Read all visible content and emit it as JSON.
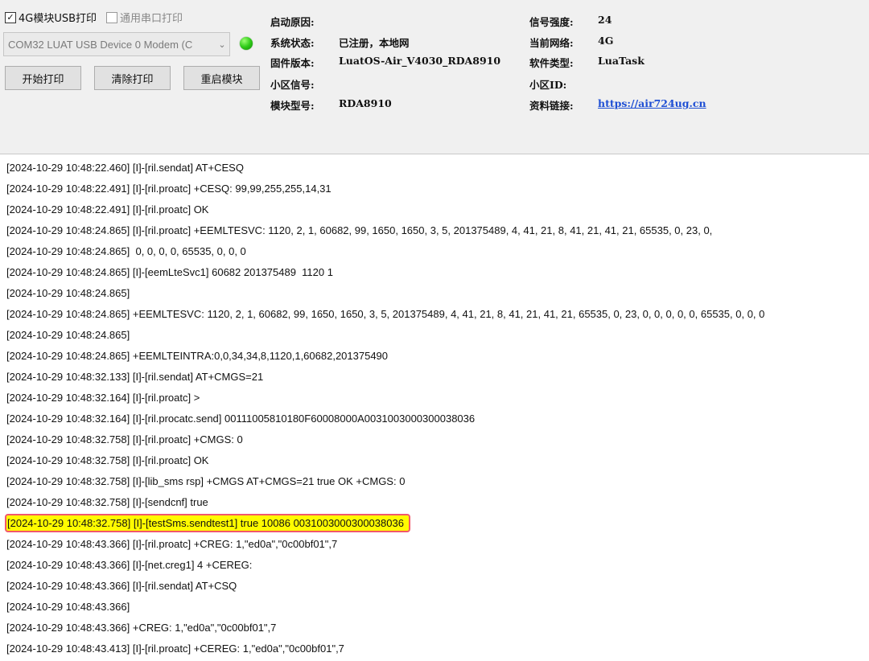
{
  "controls": {
    "checkbox_usb": {
      "label": "4G模块USB打印",
      "checked": true
    },
    "checkbox_serial": {
      "label": "通用串口打印",
      "checked": false
    },
    "port_select_value": "COM32 LUAT USB Device 0 Modem (C",
    "status_led_color": "#2fcb18",
    "buttons": {
      "start": "开始打印",
      "clear": "清除打印",
      "restart": "重启模块"
    }
  },
  "info_left": [
    {
      "label": "启动原因:",
      "value": ""
    },
    {
      "label": "系统状态:",
      "value": "已注册，本地网"
    },
    {
      "label": "固件版本:",
      "value": "LuatOS-Air_V4030_RDA8910"
    },
    {
      "label": "小区信号:",
      "value": ""
    },
    {
      "label": "模块型号:",
      "value": "RDA8910"
    }
  ],
  "info_right": [
    {
      "label": "信号强度:",
      "value": "24"
    },
    {
      "label": "当前网络:",
      "value": "4G"
    },
    {
      "label": "软件类型:",
      "value": "LuaTask"
    },
    {
      "label": "小区ID:",
      "value": ""
    },
    {
      "label": "资料链接:",
      "value": "https://air724ug.cn"
    }
  ],
  "log_lines": [
    "[2024-10-29 10:48:22.460] [I]-[ril.sendat] AT+CESQ",
    "[2024-10-29 10:48:22.491] [I]-[ril.proatc] +CESQ: 99,99,255,255,14,31",
    "[2024-10-29 10:48:22.491] [I]-[ril.proatc] OK",
    "[2024-10-29 10:48:24.865] [I]-[ril.proatc] +EEMLTESVC: 1120, 2, 1, 60682, 99, 1650, 1650, 3, 5, 201375489, 4, 41, 21, 8, 41, 21, 41, 21, 65535, 0, 23, 0,",
    "[2024-10-29 10:48:24.865]  0, 0, 0, 0, 65535, 0, 0, 0",
    "[2024-10-29 10:48:24.865] [I]-[eemLteSvc1] 60682 201375489  1120 1",
    "[2024-10-29 10:48:24.865]",
    "[2024-10-29 10:48:24.865] +EEMLTESVC: 1120, 2, 1, 60682, 99, 1650, 1650, 3, 5, 201375489, 4, 41, 21, 8, 41, 21, 41, 21, 65535, 0, 23, 0, 0, 0, 0, 0, 65535, 0, 0, 0",
    "[2024-10-29 10:48:24.865]",
    "[2024-10-29 10:48:24.865] +EEMLTEINTRA:0,0,34,34,8,1120,1,60682,201375490",
    "[2024-10-29 10:48:32.133] [I]-[ril.sendat] AT+CMGS=21",
    "[2024-10-29 10:48:32.164] [I]-[ril.proatc] >",
    "[2024-10-29 10:48:32.164] [I]-[ril.procatc.send] 00111005810180F60008000A0031003000300038036",
    "[2024-10-29 10:48:32.758] [I]-[ril.proatc] +CMGS: 0",
    "[2024-10-29 10:48:32.758] [I]-[ril.proatc] OK",
    "[2024-10-29 10:48:32.758] [I]-[lib_sms rsp] +CMGS AT+CMGS=21 true OK +CMGS: 0",
    "[2024-10-29 10:48:32.758] [I]-[sendcnf] true",
    "[2024-10-29 10:48:32.758] [I]-[testSms.sendtest1] true 10086 0031003000300038036",
    "[2024-10-29 10:48:43.366] [I]-[ril.proatc] +CREG: 1,\"ed0a\",\"0c00bf01\",7",
    "[2024-10-29 10:48:43.366] [I]-[net.creg1] 4 +CEREG:",
    "[2024-10-29 10:48:43.366] [I]-[ril.sendat] AT+CSQ",
    "[2024-10-29 10:48:43.366]",
    "[2024-10-29 10:48:43.366] +CREG: 1,\"ed0a\",\"0c00bf01\",7",
    "[2024-10-29 10:48:43.413] [I]-[ril.proatc] +CEREG: 1,\"ed0a\",\"0c00bf01\",7"
  ],
  "highlight": {
    "line_index": 17,
    "fill": "#fffb00",
    "border": "#f1576b"
  }
}
